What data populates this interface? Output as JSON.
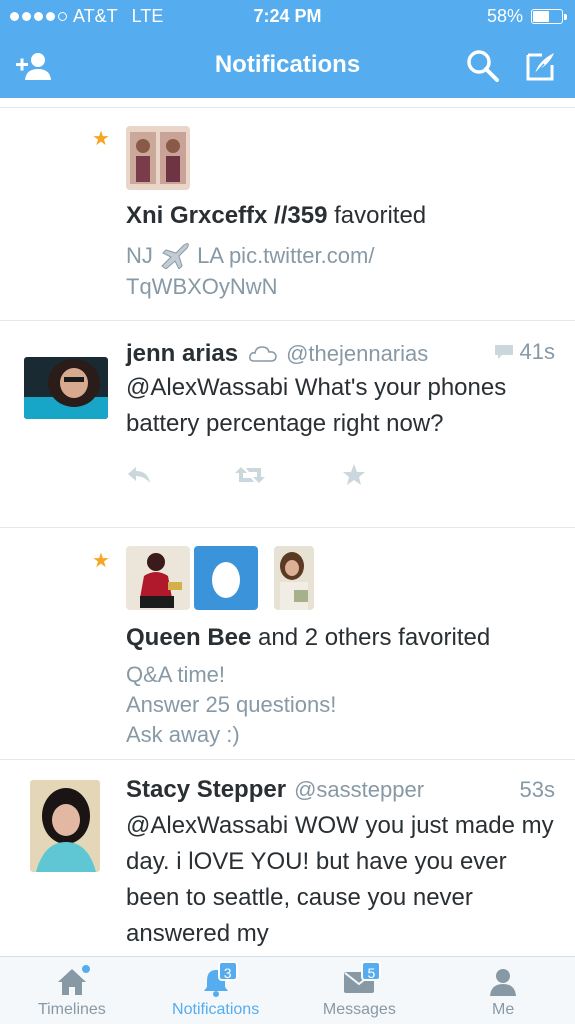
{
  "status_bar": {
    "carrier": "AT&T",
    "network": "LTE",
    "time": "7:24 PM",
    "battery": "58%",
    "battery_level": 0.58,
    "signal_bars": 4
  },
  "nav": {
    "title": "Notifications",
    "icons": [
      "add-user-icon",
      "search-icon",
      "compose-icon"
    ]
  },
  "feed": {
    "fav1": {
      "user": "Xni Grxceffx //359",
      "action": " favorited",
      "tweet_prefix": "NJ",
      "tweet_rest": "LA pic.twitter.com/",
      "tweet_line2": "TqWBXOyNwN"
    },
    "tweet1": {
      "name": "jenn arias",
      "handle": "@thejennarias",
      "time": "41s",
      "text": "@AlexWassabi What's your phones battery percentage right now?"
    },
    "fav2": {
      "user": "Queen Bee",
      "action": " and 2 others favorited",
      "lines": [
        "Q&A time!",
        "Answer 25 questions!",
        "Ask away :)"
      ]
    },
    "tweet2": {
      "name": "Stacy Stepper",
      "handle": "@sasstepper",
      "time": "53s",
      "text": "@AlexWassabi WOW you just made my day. i lOVE YOU! but have you ever been to seattle, cause you never answered my"
    }
  },
  "tabs": [
    {
      "label": "Timelines",
      "icon": "home-icon",
      "badge": ""
    },
    {
      "label": "Notifications",
      "icon": "bell-icon",
      "badge": "3"
    },
    {
      "label": "Messages",
      "icon": "envelope-icon",
      "badge": "5"
    },
    {
      "label": "Me",
      "icon": "person-icon",
      "badge": ""
    }
  ],
  "colors": {
    "brand": "#55acee",
    "star": "#f5a623",
    "muted": "#8899a6"
  }
}
